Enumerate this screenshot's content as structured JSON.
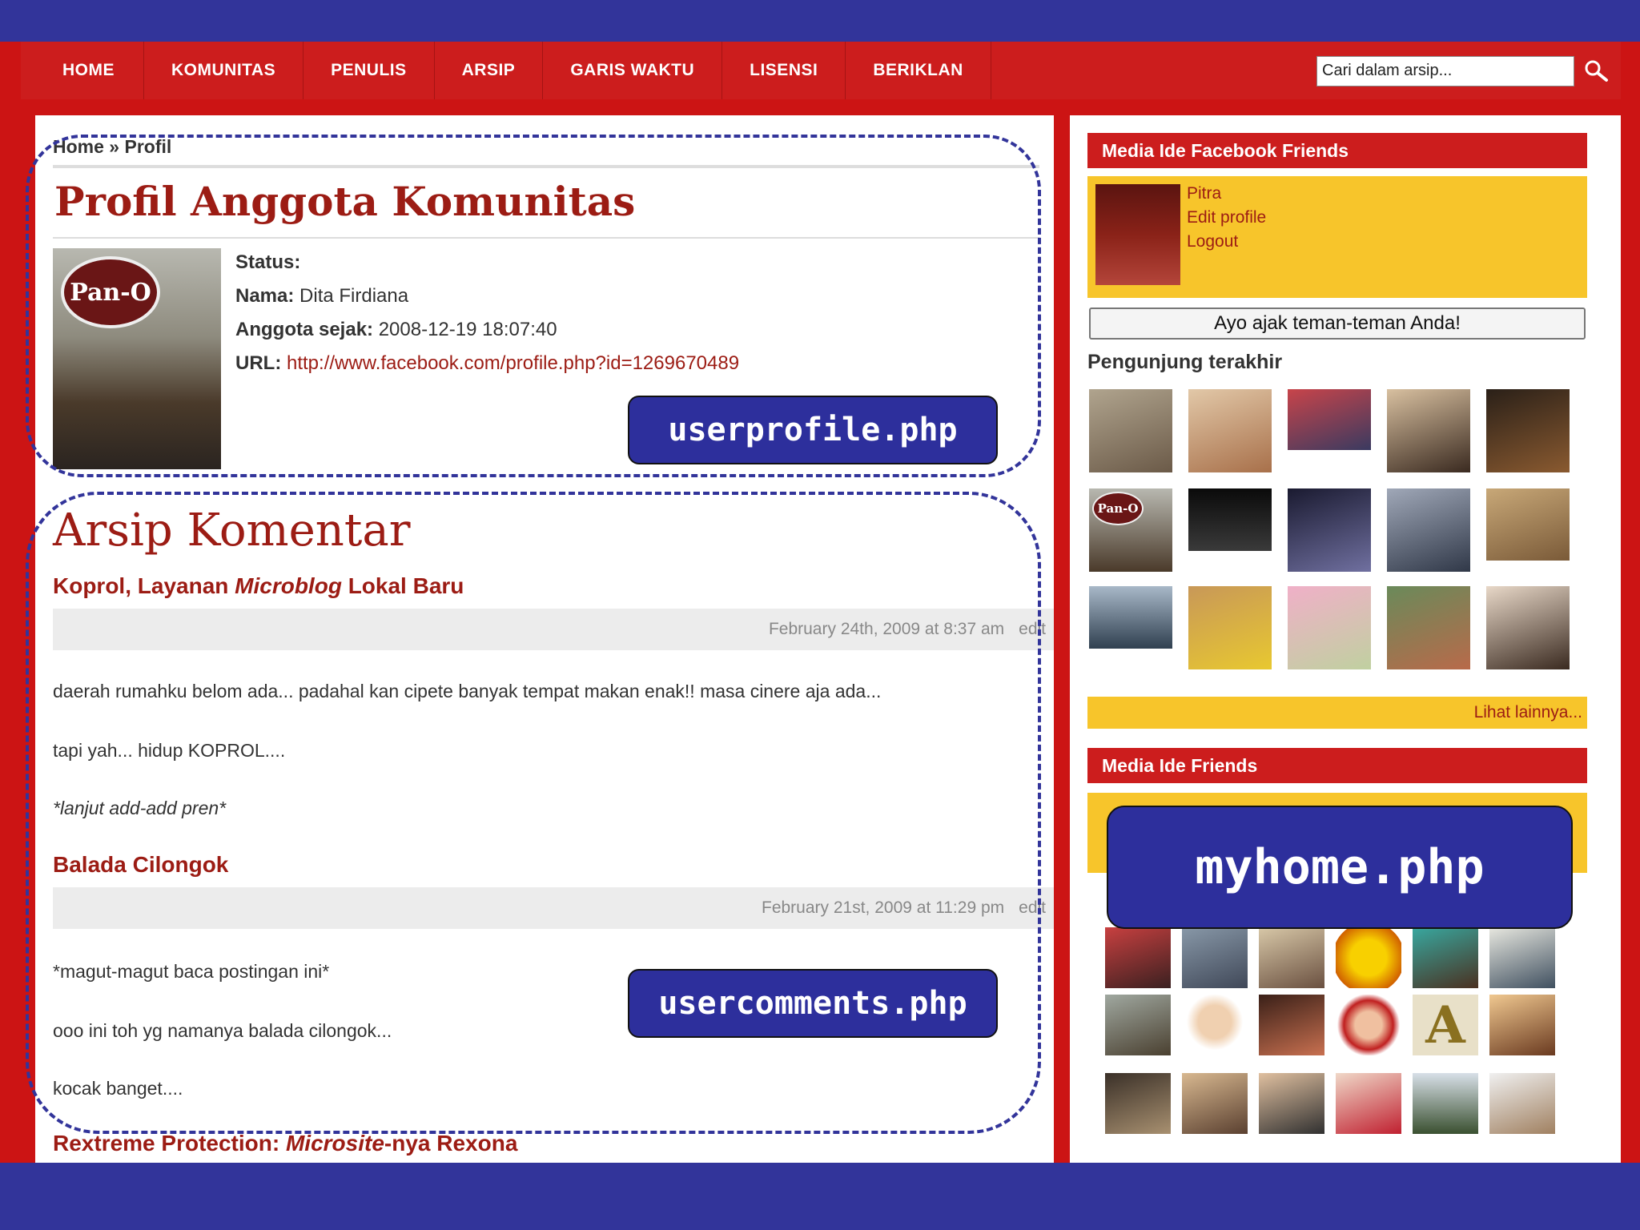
{
  "nav": {
    "items": [
      "HOME",
      "KOMUNITAS",
      "PENULIS",
      "ARSIP",
      "GARIS WAKTU",
      "LISENSI",
      "BERIKLAN"
    ],
    "search_value": "Cari dalam arsip..."
  },
  "profile": {
    "breadcrumb": "Home » Profil",
    "title": "Profil Anggota Komunitas",
    "avatar_logo": "Pan-O",
    "status_label": "Status:",
    "name_label": "Nama:",
    "name_value": "Dita Firdiana",
    "since_label": "Anggota sejak:",
    "since_value": "2008-12-19 18:07:40",
    "url_label": "URL:",
    "url_value": "http://www.facebook.com/profile.php?id=1269670489"
  },
  "labels": {
    "userprofile": "userprofile.php",
    "usercomments": "usercomments.php",
    "myhome": "myhome.php"
  },
  "comments": {
    "title": "Arsip Komentar",
    "posts": [
      {
        "title_a": "Koprol, Layanan ",
        "title_em": "Microblog",
        "title_b": " Lokal Baru",
        "date": "February 24th, 2009 at 8:37 am",
        "edit": "edit",
        "lines": [
          "daerah rumahku belom ada... padahal kan cipete banyak tempat makan enak!! masa cinere aja ada...",
          "tapi yah... hidup KOPROL....",
          "*lanjut add-add pren*"
        ]
      },
      {
        "title_a": "Balada Cilongok",
        "date": "February 21st, 2009 at 11:29 pm",
        "edit": "edit",
        "lines": [
          "*magut-magut baca postingan ini*",
          "ooo ini toh yg namanya balada cilongok...",
          "kocak banget...."
        ]
      },
      {
        "title_a": "Rextreme Protection: ",
        "title_em": "Microsite",
        "title_b": "-nya Rexona"
      }
    ]
  },
  "sidebar": {
    "fb_header": "Media Ide Facebook Friends",
    "fb_links": [
      "Pitra",
      "Edit profile",
      "Logout"
    ],
    "invite_button": "Ayo ajak teman-teman Anda!",
    "visitors_title": "Pengunjung terakhir",
    "more_link": "Lihat lainnya...",
    "friends_header": "Media Ide Friends",
    "visitor_logo": "Pan-O",
    "friend_letter": "A"
  }
}
